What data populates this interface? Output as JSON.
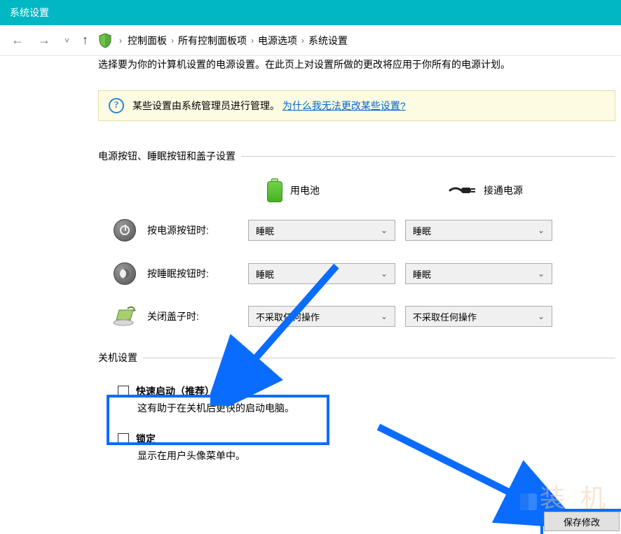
{
  "window": {
    "title": "系统设置"
  },
  "breadcrumbs": [
    "控制面板",
    "所有控制面板项",
    "电源选项",
    "系统设置"
  ],
  "description": "选择要为你的计算机设置的电源设置。在此页上对设置所做的更改将应用于你所有的电源计划。",
  "info": {
    "text_prefix": "某些设置由系统管理员进行管理。",
    "link": "为什么我无法更改某些设置?"
  },
  "sections": {
    "buttons_title": "电源按钮、睡眠按钮和盖子设置",
    "shutdown_title": "关机设置"
  },
  "columns": {
    "battery": "用电池",
    "plugged": "接通电源"
  },
  "rows": {
    "power_button": {
      "label": "按电源按钮时:",
      "battery": "睡眠",
      "plugged": "睡眠"
    },
    "sleep_button": {
      "label": "按睡眠按钮时:",
      "battery": "睡眠",
      "plugged": "睡眠"
    },
    "close_lid": {
      "label": "关闭盖子时:",
      "battery": "不采取任何操作",
      "plugged": "不采取任何操作"
    }
  },
  "shutdown_items": [
    {
      "title": "快速启动（推荐）",
      "desc": "这有助于在关机后更快的启动电脑。",
      "checked": false
    },
    {
      "title": "锁定",
      "desc": "显示在用户头像菜单中。",
      "checked": false
    }
  ],
  "buttons": {
    "save": "保存修改"
  },
  "icons": {
    "shield": "shield-icon",
    "info": "info-icon",
    "battery": "battery-icon",
    "plug": "plug-icon",
    "power": "power-button-icon",
    "sleep": "sleep-button-icon",
    "lid": "laptop-lid-icon",
    "chevron": "chevron-down-icon",
    "checkbox": "checkbox-icon"
  }
}
